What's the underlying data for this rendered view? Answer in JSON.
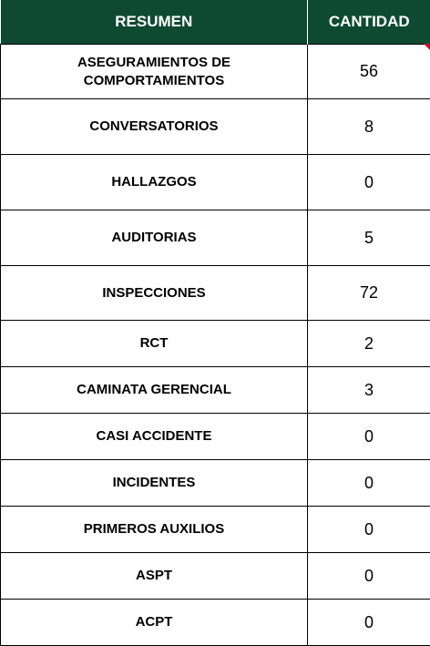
{
  "table": {
    "headers": {
      "summary": "RESUMEN",
      "quantity": "CANTIDAD"
    },
    "rows": [
      {
        "label": "ASEGURAMIENTOS DE COMPORTAMIENTOS",
        "value": "56"
      },
      {
        "label": "CONVERSATORIOS",
        "value": "8"
      },
      {
        "label": "HALLAZGOS",
        "value": "0"
      },
      {
        "label": "AUDITORIAS",
        "value": "5"
      },
      {
        "label": "INSPECCIONES",
        "value": "72"
      },
      {
        "label": "RCT",
        "value": "2"
      },
      {
        "label": "CAMINATA GERENCIAL",
        "value": "3"
      },
      {
        "label": "CASI ACCIDENTE",
        "value": "0"
      },
      {
        "label": "INCIDENTES",
        "value": "0"
      },
      {
        "label": "PRIMEROS AUXILIOS",
        "value": "0"
      },
      {
        "label": "ASPT",
        "value": "0"
      },
      {
        "label": "ACPT",
        "value": "0"
      }
    ]
  },
  "colors": {
    "header_background": "#0e4a32",
    "header_text": "#ffffff",
    "comment_marker": "#c8102e"
  }
}
